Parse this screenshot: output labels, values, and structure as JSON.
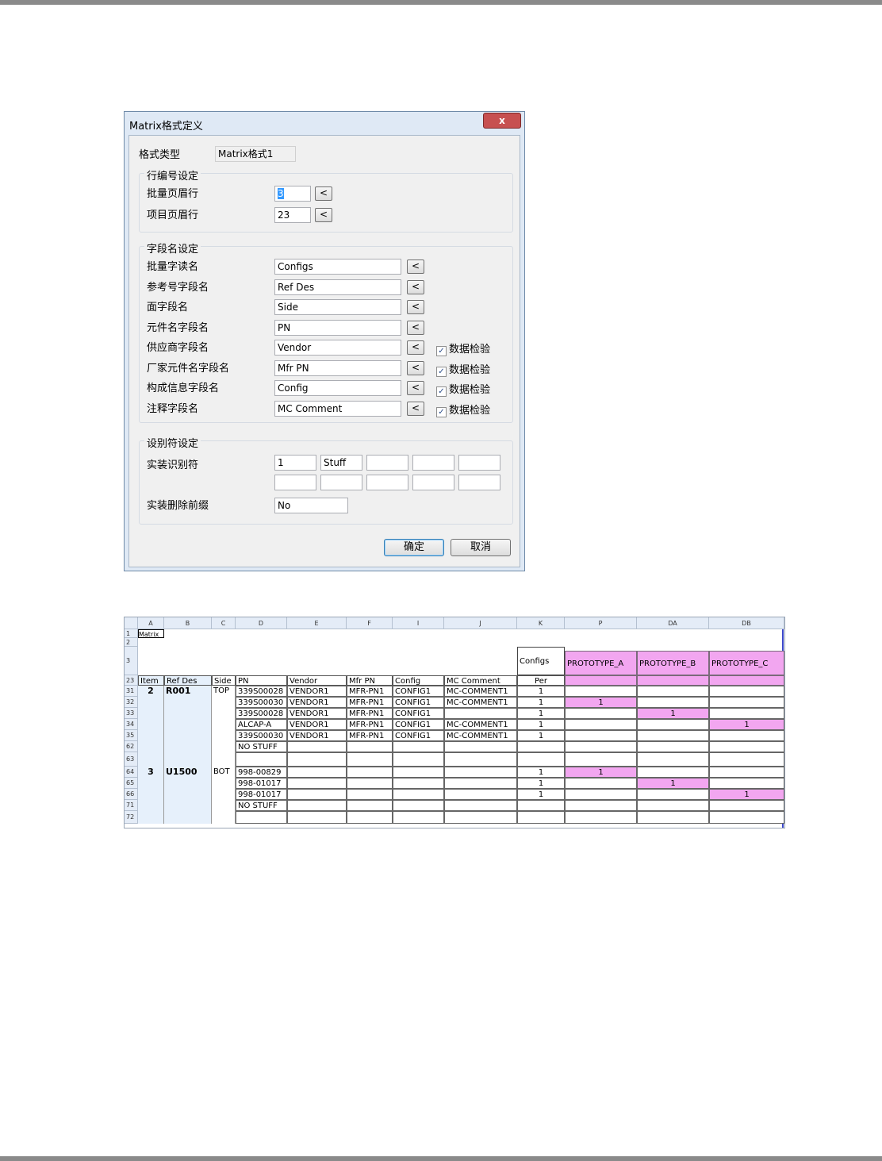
{
  "dialog": {
    "title": "Matrix格式定义",
    "close_label": "x",
    "format_type_label": "格式类型",
    "format_type_value": "Matrix格式1",
    "row_group": {
      "title": "行编号设定",
      "batch_header_label": "批量页眉行",
      "batch_header_value": "3",
      "item_header_label": "项目页眉行",
      "item_header_value": "23",
      "pick_label": "<"
    },
    "field_group": {
      "title": "字段名设定",
      "check_label": "数据检验",
      "rows": [
        {
          "label": "批量字读名",
          "value": "Configs"
        },
        {
          "label": "参考号字段名",
          "value": "Ref Des"
        },
        {
          "label": "面字段名",
          "value": "Side"
        },
        {
          "label": "元件名字段名",
          "value": " PN"
        },
        {
          "label": "供应商字段名",
          "value": "Vendor"
        },
        {
          "label": "厂家元件名字段名",
          "value": "Mfr PN"
        },
        {
          "label": "构成信息字段名",
          "value": "Config"
        },
        {
          "label": "注释字段名",
          "value": "MC Comment"
        }
      ]
    },
    "ident_group": {
      "title": "设别符设定",
      "mount_label": "实装识别符",
      "mount_values": [
        "1",
        "Stuff",
        "",
        "",
        "",
        "",
        "",
        "",
        "",
        ""
      ],
      "prefix_label": "实装删除前缀",
      "prefix_value": "No"
    },
    "ok_label": "确定",
    "cancel_label": "取消"
  },
  "sheet": {
    "col_letters": [
      "A",
      "B",
      "C",
      "D",
      "E",
      "F",
      "I",
      "J",
      "K",
      "P",
      "DA",
      "DB"
    ],
    "row_numbers": [
      "1",
      "2",
      "3",
      "23",
      "31",
      "32",
      "33",
      "34",
      "35",
      "62",
      "63",
      "64",
      "65",
      "66",
      "71",
      "72"
    ],
    "a1_text": "Matrix",
    "configs_header": "Configs",
    "prototypes": [
      "PROTOTYPE_A",
      "PROTOTYPE_B",
      "PROTOTYPE_C"
    ],
    "headers": [
      "Item",
      "Ref Des",
      "Side",
      "PN",
      "Vendor",
      "Mfr PN",
      "Config",
      "MC Comment",
      "Per"
    ],
    "rows": [
      {
        "item": "2",
        "ref": "R001",
        "side": "TOP",
        "pn": "339S00028",
        "vendor": "VENDOR1",
        "mfr": "MFR-PN1",
        "config": "CONFIG1",
        "comment": "MC-COMMENT1",
        "per": "1",
        "protos": [
          "",
          "",
          ""
        ]
      },
      {
        "item": "",
        "ref": "",
        "side": "",
        "pn": "339S00030",
        "vendor": "VENDOR1",
        "mfr": "MFR-PN1",
        "config": "CONFIG1",
        "comment": "MC-COMMENT1",
        "per": "1",
        "protos": [
          "1",
          "",
          ""
        ]
      },
      {
        "item": "",
        "ref": "",
        "side": "",
        "pn": "339S00028",
        "vendor": "VENDOR1",
        "mfr": "MFR-PN1",
        "config": "CONFIG1",
        "comment": "",
        "per": "1",
        "protos": [
          "",
          "1",
          ""
        ]
      },
      {
        "item": "",
        "ref": "",
        "side": "",
        "pn": "ALCAP-A",
        "vendor": "VENDOR1",
        "mfr": "MFR-PN1",
        "config": "CONFIG1",
        "comment": "MC-COMMENT1",
        "per": "1",
        "protos": [
          "",
          "",
          "1"
        ]
      },
      {
        "item": "",
        "ref": "",
        "side": "",
        "pn": "339S00030",
        "vendor": "VENDOR1",
        "mfr": "MFR-PN1",
        "config": "CONFIG1",
        "comment": "MC-COMMENT1",
        "per": "1",
        "protos": [
          "",
          "",
          ""
        ]
      },
      {
        "item": "",
        "ref": "",
        "side": "",
        "pn": "NO STUFF",
        "vendor": "",
        "mfr": "",
        "config": "",
        "comment": "",
        "per": "",
        "protos": [
          "",
          "",
          ""
        ]
      },
      {
        "item": "",
        "ref": "",
        "side": "",
        "pn": "",
        "vendor": "",
        "mfr": "",
        "config": "",
        "comment": "",
        "per": "",
        "protos": [
          "",
          "",
          ""
        ]
      },
      {
        "item": "3",
        "ref": "U1500",
        "side": "BOT",
        "pn": "998-00829",
        "vendor": "",
        "mfr": "",
        "config": "",
        "comment": "",
        "per": "1",
        "protos": [
          "1",
          "",
          ""
        ]
      },
      {
        "item": "",
        "ref": "",
        "side": "",
        "pn": "998-01017",
        "vendor": "",
        "mfr": "",
        "config": "",
        "comment": "",
        "per": "1",
        "protos": [
          "",
          "1",
          ""
        ]
      },
      {
        "item": "",
        "ref": "",
        "side": "",
        "pn": "998-01017",
        "vendor": "",
        "mfr": "",
        "config": "",
        "comment": "",
        "per": "1",
        "protos": [
          "",
          "",
          "1"
        ]
      },
      {
        "item": "",
        "ref": "",
        "side": "",
        "pn": "NO STUFF",
        "vendor": "",
        "mfr": "",
        "config": "",
        "comment": "",
        "per": "",
        "protos": [
          "",
          "",
          ""
        ]
      },
      {
        "item": "",
        "ref": "",
        "side": "",
        "pn": "",
        "vendor": "",
        "mfr": "",
        "config": "",
        "comment": "",
        "per": "",
        "protos": [
          "",
          "",
          ""
        ]
      }
    ]
  },
  "colors": {
    "prototype_fill": "#f2a6f0",
    "selection_fill": "#e6f0fb",
    "frame_blue": "#3a46c8"
  }
}
